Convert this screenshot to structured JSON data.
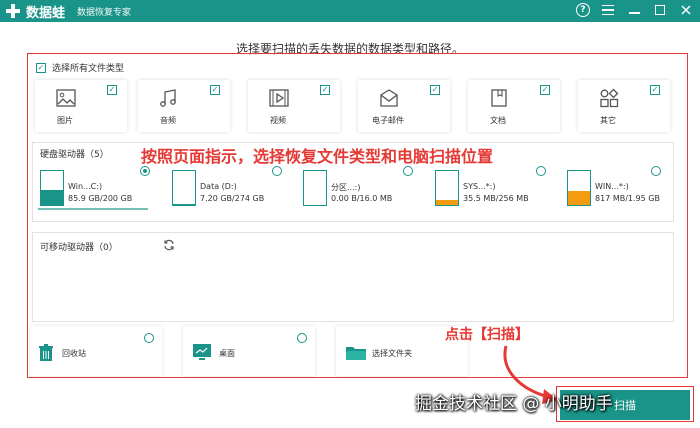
{
  "titlebar": {
    "brand": "数据蛙",
    "subtitle": "数据恢复专家",
    "help_icon": "?",
    "colors": {
      "brand": "#1a9488",
      "annotation": "#e53935"
    }
  },
  "heading": "选择要扫描的丢失数据的数据类型和路径。",
  "select_all": {
    "label": "选择所有文件类型",
    "checked": true
  },
  "file_types": [
    {
      "label": "图片",
      "icon": "image-icon",
      "checked": true
    },
    {
      "label": "音频",
      "icon": "music-icon",
      "checked": true
    },
    {
      "label": "视频",
      "icon": "video-icon",
      "checked": true
    },
    {
      "label": "电子邮件",
      "icon": "mail-icon",
      "checked": true
    },
    {
      "label": "文档",
      "icon": "document-icon",
      "checked": true
    },
    {
      "label": "其它",
      "icon": "other-icon",
      "checked": true
    }
  ],
  "hard_drives": {
    "title": "硬盘驱动器（5）",
    "items": [
      {
        "name": "Win...C:)",
        "size": "85.9 GB/200 GB",
        "used_fraction": 0.43,
        "fill_color": "#1a9488",
        "selected": true
      },
      {
        "name": "Data (D:)",
        "size": "7.20 GB/274 GB",
        "used_fraction": 0.03,
        "fill_color": "#1a9488",
        "selected": false
      },
      {
        "name": "分区...:)",
        "size": "0.00  B/16.0 MB",
        "used_fraction": 0.0,
        "fill_color": "#1a9488",
        "selected": false
      },
      {
        "name": "SYS...*:)",
        "size": "35.5 MB/256 MB",
        "used_fraction": 0.14,
        "fill_color": "#f39c12",
        "selected": false
      },
      {
        "name": "WIN...*:)",
        "size": "817 MB/1.95 GB",
        "used_fraction": 0.41,
        "fill_color": "#f39c12",
        "selected": false
      }
    ]
  },
  "removable": {
    "title": "可移动驱动器（0）",
    "refresh_icon": "refresh-icon"
  },
  "locations": [
    {
      "label": "回收站",
      "icon": "trash-icon"
    },
    {
      "label": "桌面",
      "icon": "desktop-icon"
    },
    {
      "label": "选择文件夹",
      "icon": "folder-icon"
    }
  ],
  "scan_button": {
    "label": "扫描"
  },
  "annotations": {
    "main": "按照页面指示，选择恢复文件类型和电脑扫描位置",
    "scan": "点击【扫描】"
  },
  "watermark": "掘金技术社区 @ 小明助手"
}
